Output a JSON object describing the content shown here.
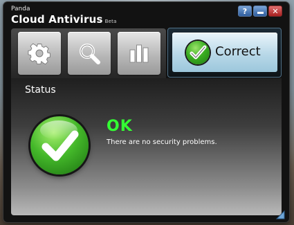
{
  "window": {
    "brand_small": "Panda",
    "brand_main": "Cloud Antivirus",
    "brand_beta": "Beta"
  },
  "controls": {
    "help_label": "?",
    "close_label": "✕"
  },
  "toolbar": {
    "items": [
      {
        "icon": "gear-icon"
      },
      {
        "icon": "search-icon"
      },
      {
        "icon": "bar-chart-icon"
      }
    ],
    "status_tab_label": "Correct"
  },
  "content": {
    "section_title": "Status",
    "status_headline": "OK",
    "status_message": "There are no security problems."
  },
  "colors": {
    "ok_green": "#33ff33",
    "accent_blue": "#4f6f86"
  }
}
